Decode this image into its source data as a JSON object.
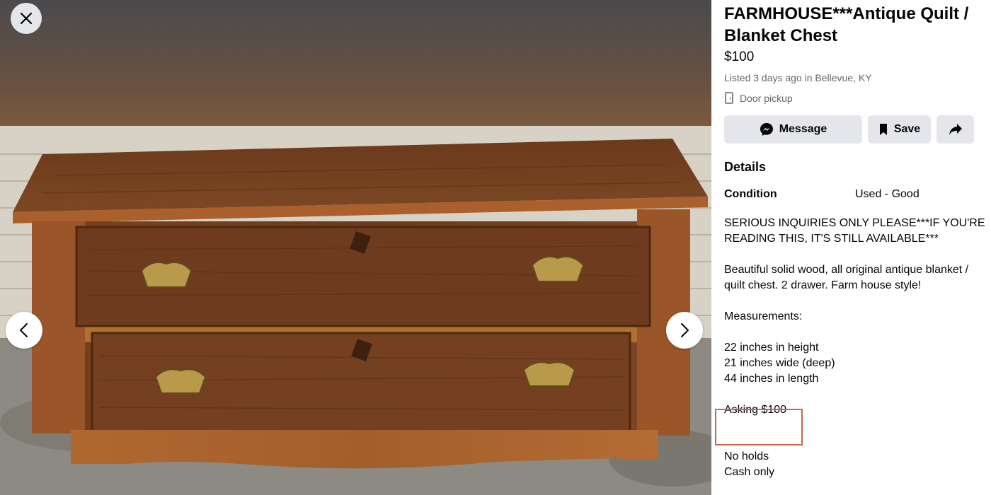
{
  "viewer": {
    "close_icon": "close-icon",
    "prev_icon": "chevron-left-icon",
    "next_icon": "chevron-right-icon"
  },
  "listing": {
    "title": "FARMHOUSE***Antique Quilt / Blanket Chest",
    "price": "$100",
    "listed": "Listed 3 days ago in Bellevue, KY",
    "pickup": "Door pickup",
    "actions": {
      "message": "Message",
      "save": "Save"
    },
    "details_heading": "Details",
    "condition_label": "Condition",
    "condition_value": "Used - Good",
    "description": {
      "line1": "SERIOUS INQUIRIES ONLY PLEASE***IF YOU'RE READING THIS, IT'S STILL AVAILABLE***",
      "line2": "Beautiful solid wood, all original antique blanket / quilt chest. 2 drawer. Farm house style!",
      "line3": "Measurements:",
      "line4": "22 inches in height",
      "line5": "21 inches wide (deep)",
      "line6": "44 inches in length",
      "line7": "Asking $100",
      "line8": "No holds",
      "line9": "Cash only"
    }
  },
  "colors": {
    "button_bg": "#e4e6eb",
    "secondary_text": "#65676b",
    "highlight_box": "#c8684a"
  }
}
